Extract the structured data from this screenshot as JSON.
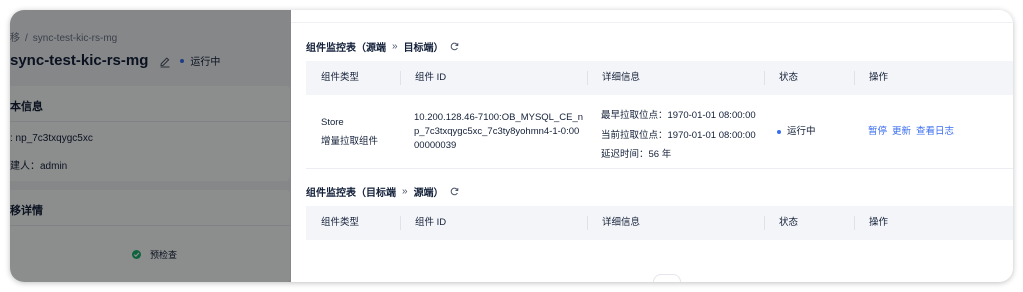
{
  "background_page": {
    "breadcrumb": {
      "parent": "移",
      "separator": "/",
      "current": "sync-test-kic-rs-mg"
    },
    "title": "sync-test-kic-rs-mg",
    "status": "运行中",
    "basic_info": {
      "heading": "本信息",
      "id_line": ": np_7c3txqygc5xc",
      "creator_line": "建人：admin"
    },
    "details": {
      "heading": "移详情",
      "precheck": "预检查"
    }
  },
  "drawer": {
    "section1": {
      "title_prefix": "组件监控表（源端",
      "arrow": "»",
      "title_suffix": "目标端）",
      "columns": [
        "组件类型",
        "组件 ID",
        "详细信息",
        "状态",
        "操作"
      ],
      "rows": [
        {
          "type_line1": "Store",
          "type_line2": "增量拉取组件",
          "component_id_line1": "10.200.128.46-7100:OB_MYSQL_CE_n",
          "component_id_line2": "p_7c3txqygc5xc_7c3ty8yohmn4-1-0:00",
          "component_id_line3": "00000039",
          "detail_line1": "最早拉取位点：1970-01-01 08:00:00",
          "detail_line2": "当前拉取位点：1970-01-01 08:00:00",
          "detail_line3": "延迟时间：56 年",
          "status": "运行中",
          "actions": {
            "pause": "暂停",
            "update": "更新",
            "logs": "查看日志"
          }
        }
      ]
    },
    "section2": {
      "title_prefix": "组件监控表（目标端",
      "arrow": "»",
      "title_suffix": "源端）",
      "columns": [
        "组件类型",
        "组件 ID",
        "详细信息",
        "状态",
        "操作"
      ]
    }
  },
  "colors": {
    "accent": "#3a6df0",
    "success": "#19b26b",
    "header_bg": "#f4f5f8",
    "overlay": "rgba(0,0,0,0.44)"
  },
  "icons": [
    "edit-icon",
    "refresh-icon",
    "check-circle-icon",
    "status-dot-icon"
  ]
}
